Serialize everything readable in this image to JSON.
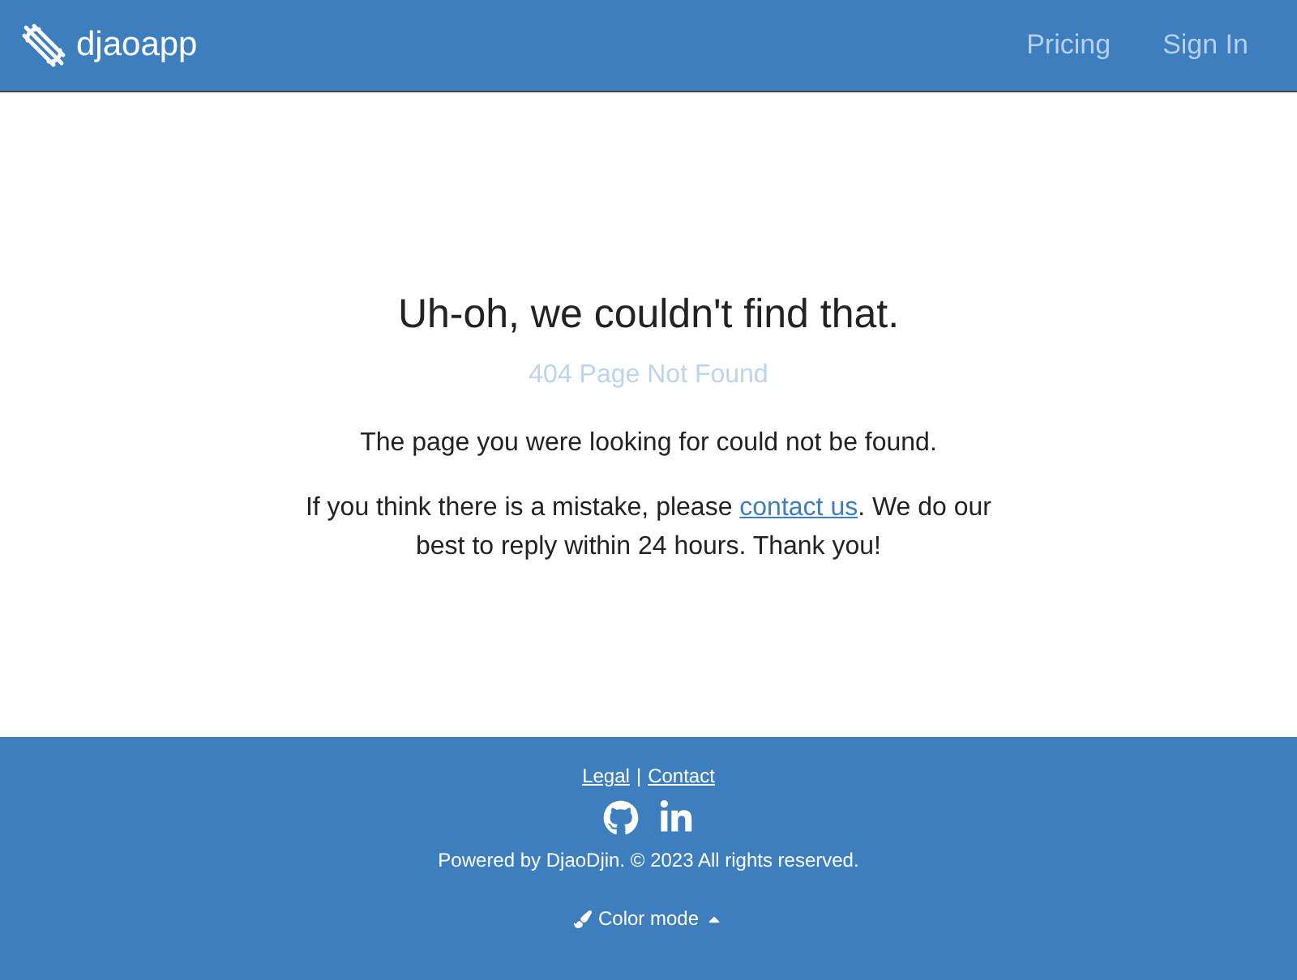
{
  "header": {
    "brand": "djaoapp",
    "nav": [
      "Pricing",
      "Sign In"
    ]
  },
  "main": {
    "title": "Uh-oh, we couldn't find that.",
    "subtitle": "404 Page Not Found",
    "message": "The page you were looking for could not be found.",
    "help": {
      "before": "If you think there is a mistake, please ",
      "link": "contact us",
      "after": ". We do our best to reply within 24 hours. Thank you!"
    }
  },
  "footer": {
    "links": [
      "Legal",
      "Contact"
    ],
    "separator": "|",
    "copyright": "Powered by DjaoDjin. © 2023 All rights reserved.",
    "color_mode": "Color mode"
  }
}
